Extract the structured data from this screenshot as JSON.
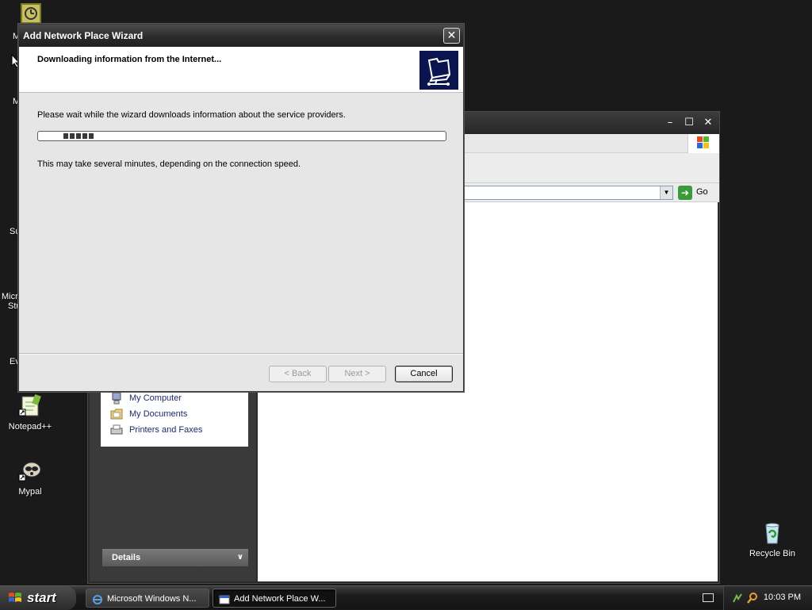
{
  "desktop": {
    "icons": [
      {
        "label": "Notepad++"
      },
      {
        "label": "Mypal"
      },
      {
        "label": "Recycle Bin"
      }
    ],
    "partial_labels": [
      "M",
      "M",
      "Su",
      "Micro",
      "Stu",
      "Ev"
    ]
  },
  "explorer": {
    "address_go_label": "Go",
    "other_places": [
      {
        "label": "My Computer",
        "icon": "my-computer-icon"
      },
      {
        "label": "My Documents",
        "icon": "my-documents-icon"
      },
      {
        "label": "Printers and Faxes",
        "icon": "printers-icon"
      }
    ],
    "details_label": "Details"
  },
  "wizard": {
    "title": "Add Network Place Wizard",
    "header_title": "Downloading information from the Internet...",
    "wait_text": "Please wait while the wizard downloads information about the service providers.",
    "speed_text": "This may take several minutes, depending on the connection speed.",
    "buttons": {
      "back": "< Back",
      "next": "Next >",
      "cancel": "Cancel"
    },
    "progress_blocks": 5
  },
  "taskbar": {
    "start_label": "start",
    "tasks": [
      {
        "label": "Microsoft Windows N...",
        "active": false
      },
      {
        "label": "Add Network Place W...",
        "active": true
      }
    ],
    "clock": "10:03 PM"
  },
  "colors": {
    "wizard_header_icon_bg": "#0a1550",
    "go_arrow": "#3b9b3b"
  }
}
